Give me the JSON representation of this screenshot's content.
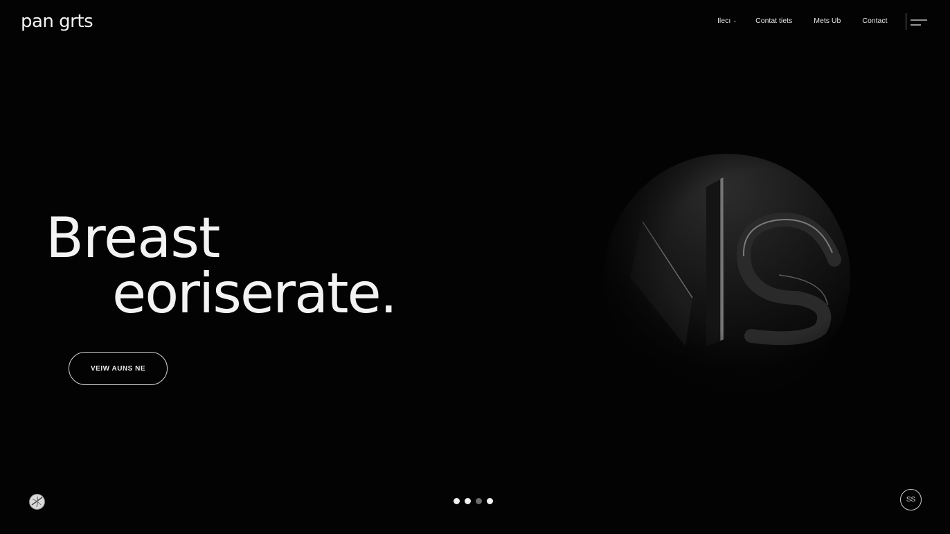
{
  "brand": {
    "logo_text": "pan grts"
  },
  "nav": {
    "items": [
      {
        "label": "Ilecı",
        "has_dropdown": true
      },
      {
        "label": "Contat tiets"
      },
      {
        "label": "Mets Ub"
      },
      {
        "label": "Contact"
      }
    ],
    "menu_icon": "hamburger-menu-icon"
  },
  "hero": {
    "line_1": "Breast",
    "line_2": "eoriserate.",
    "cta_label": "VEIW  AUNS NE",
    "visual_icon": "dark-sphere-letters-graphic"
  },
  "footer": {
    "left_icon": "globe-icon",
    "slides": {
      "count": 4,
      "active": [
        true,
        true,
        false,
        true
      ]
    },
    "badge_text": "SS"
  },
  "colors": {
    "background": "#030303",
    "text": "#f2f2f2",
    "dot_dim": "#6c6c6c"
  }
}
